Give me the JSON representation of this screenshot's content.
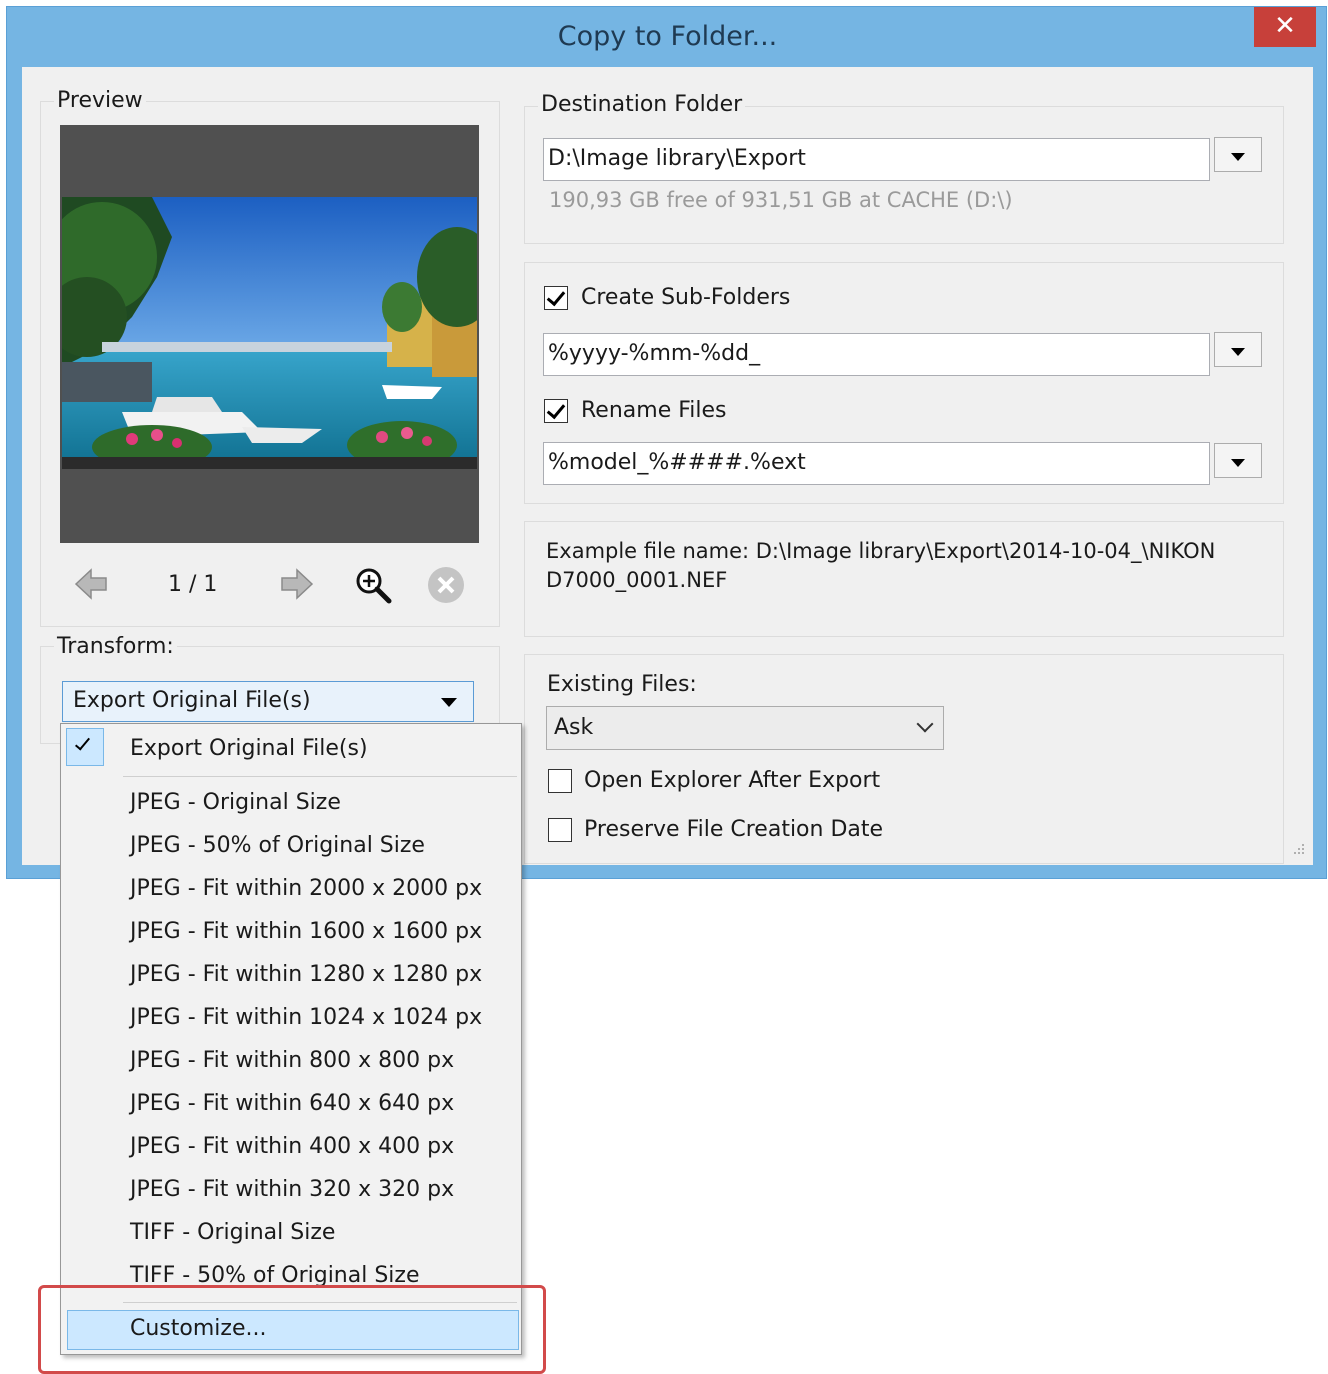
{
  "window": {
    "title": "Copy to Folder...",
    "close_glyph": "✕"
  },
  "preview": {
    "legend": "Preview",
    "page_indicator": "1 / 1",
    "icons": [
      "arrow-left-icon",
      "arrow-right-icon",
      "zoom-in-icon",
      "close-circle-icon"
    ]
  },
  "transform": {
    "legend": "Transform:",
    "selected": "Export Original File(s)"
  },
  "destination": {
    "legend": "Destination Folder",
    "path": "D:\\Image library\\Export",
    "free_space": "190,93 GB free of 931,51 GB at CACHE (D:\\)"
  },
  "subfolders": {
    "create_label": "Create Sub-Folders",
    "create_checked": true,
    "pattern": "%yyyy-%mm-%dd_",
    "rename_label": "Rename Files",
    "rename_checked": true,
    "rename_pattern": "%model_%####.%ext"
  },
  "example": {
    "line1": "Example file name: D:\\Image library\\Export\\2014-10-04_\\NIKON",
    "line2": "D7000_0001.NEF"
  },
  "existing": {
    "label": "Existing Files:",
    "value": "Ask",
    "open_explorer_label": "Open Explorer After Export",
    "open_explorer_checked": false,
    "preserve_date_label": "Preserve File Creation Date",
    "preserve_date_checked": false
  },
  "menu": {
    "checked_item": "Export Original File(s)",
    "items": [
      "JPEG - Original Size",
      "JPEG - 50% of Original Size",
      "JPEG - Fit within 2000 x 2000 px",
      "JPEG - Fit within 1600 x 1600 px",
      "JPEG - Fit within 1280 x 1280 px",
      "JPEG - Fit within 1024 x 1024 px",
      "JPEG - Fit within 800 x 800 px",
      "JPEG - Fit within 640 x 640 px",
      "JPEG - Fit within 400 x 400 px",
      "JPEG - Fit within 320 x 320 px",
      "TIFF - Original Size",
      "TIFF - 50% of Original Size"
    ],
    "customize": "Customize..."
  },
  "colors": {
    "title_bar": "#75b5e3",
    "close_button": "#c7403a",
    "menu_highlight": "#cce8ff",
    "callout_red": "#d24a4a"
  }
}
